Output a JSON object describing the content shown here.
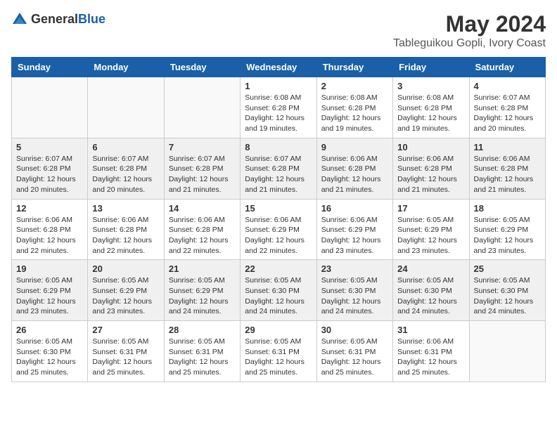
{
  "logo": {
    "text_general": "General",
    "text_blue": "Blue"
  },
  "header": {
    "title": "May 2024",
    "subtitle": "Tableguikou Gopli, Ivory Coast"
  },
  "calendar": {
    "days_of_week": [
      "Sunday",
      "Monday",
      "Tuesday",
      "Wednesday",
      "Thursday",
      "Friday",
      "Saturday"
    ],
    "weeks": [
      {
        "shaded": false,
        "days": [
          {
            "number": "",
            "info": ""
          },
          {
            "number": "",
            "info": ""
          },
          {
            "number": "",
            "info": ""
          },
          {
            "number": "1",
            "info": "Sunrise: 6:08 AM\nSunset: 6:28 PM\nDaylight: 12 hours\nand 19 minutes."
          },
          {
            "number": "2",
            "info": "Sunrise: 6:08 AM\nSunset: 6:28 PM\nDaylight: 12 hours\nand 19 minutes."
          },
          {
            "number": "3",
            "info": "Sunrise: 6:08 AM\nSunset: 6:28 PM\nDaylight: 12 hours\nand 19 minutes."
          },
          {
            "number": "4",
            "info": "Sunrise: 6:07 AM\nSunset: 6:28 PM\nDaylight: 12 hours\nand 20 minutes."
          }
        ]
      },
      {
        "shaded": true,
        "days": [
          {
            "number": "5",
            "info": "Sunrise: 6:07 AM\nSunset: 6:28 PM\nDaylight: 12 hours\nand 20 minutes."
          },
          {
            "number": "6",
            "info": "Sunrise: 6:07 AM\nSunset: 6:28 PM\nDaylight: 12 hours\nand 20 minutes."
          },
          {
            "number": "7",
            "info": "Sunrise: 6:07 AM\nSunset: 6:28 PM\nDaylight: 12 hours\nand 21 minutes."
          },
          {
            "number": "8",
            "info": "Sunrise: 6:07 AM\nSunset: 6:28 PM\nDaylight: 12 hours\nand 21 minutes."
          },
          {
            "number": "9",
            "info": "Sunrise: 6:06 AM\nSunset: 6:28 PM\nDaylight: 12 hours\nand 21 minutes."
          },
          {
            "number": "10",
            "info": "Sunrise: 6:06 AM\nSunset: 6:28 PM\nDaylight: 12 hours\nand 21 minutes."
          },
          {
            "number": "11",
            "info": "Sunrise: 6:06 AM\nSunset: 6:28 PM\nDaylight: 12 hours\nand 21 minutes."
          }
        ]
      },
      {
        "shaded": false,
        "days": [
          {
            "number": "12",
            "info": "Sunrise: 6:06 AM\nSunset: 6:28 PM\nDaylight: 12 hours\nand 22 minutes."
          },
          {
            "number": "13",
            "info": "Sunrise: 6:06 AM\nSunset: 6:28 PM\nDaylight: 12 hours\nand 22 minutes."
          },
          {
            "number": "14",
            "info": "Sunrise: 6:06 AM\nSunset: 6:28 PM\nDaylight: 12 hours\nand 22 minutes."
          },
          {
            "number": "15",
            "info": "Sunrise: 6:06 AM\nSunset: 6:29 PM\nDaylight: 12 hours\nand 22 minutes."
          },
          {
            "number": "16",
            "info": "Sunrise: 6:06 AM\nSunset: 6:29 PM\nDaylight: 12 hours\nand 23 minutes."
          },
          {
            "number": "17",
            "info": "Sunrise: 6:05 AM\nSunset: 6:29 PM\nDaylight: 12 hours\nand 23 minutes."
          },
          {
            "number": "18",
            "info": "Sunrise: 6:05 AM\nSunset: 6:29 PM\nDaylight: 12 hours\nand 23 minutes."
          }
        ]
      },
      {
        "shaded": true,
        "days": [
          {
            "number": "19",
            "info": "Sunrise: 6:05 AM\nSunset: 6:29 PM\nDaylight: 12 hours\nand 23 minutes."
          },
          {
            "number": "20",
            "info": "Sunrise: 6:05 AM\nSunset: 6:29 PM\nDaylight: 12 hours\nand 23 minutes."
          },
          {
            "number": "21",
            "info": "Sunrise: 6:05 AM\nSunset: 6:29 PM\nDaylight: 12 hours\nand 24 minutes."
          },
          {
            "number": "22",
            "info": "Sunrise: 6:05 AM\nSunset: 6:30 PM\nDaylight: 12 hours\nand 24 minutes."
          },
          {
            "number": "23",
            "info": "Sunrise: 6:05 AM\nSunset: 6:30 PM\nDaylight: 12 hours\nand 24 minutes."
          },
          {
            "number": "24",
            "info": "Sunrise: 6:05 AM\nSunset: 6:30 PM\nDaylight: 12 hours\nand 24 minutes."
          },
          {
            "number": "25",
            "info": "Sunrise: 6:05 AM\nSunset: 6:30 PM\nDaylight: 12 hours\nand 24 minutes."
          }
        ]
      },
      {
        "shaded": false,
        "days": [
          {
            "number": "26",
            "info": "Sunrise: 6:05 AM\nSunset: 6:30 PM\nDaylight: 12 hours\nand 25 minutes."
          },
          {
            "number": "27",
            "info": "Sunrise: 6:05 AM\nSunset: 6:31 PM\nDaylight: 12 hours\nand 25 minutes."
          },
          {
            "number": "28",
            "info": "Sunrise: 6:05 AM\nSunset: 6:31 PM\nDaylight: 12 hours\nand 25 minutes."
          },
          {
            "number": "29",
            "info": "Sunrise: 6:05 AM\nSunset: 6:31 PM\nDaylight: 12 hours\nand 25 minutes."
          },
          {
            "number": "30",
            "info": "Sunrise: 6:05 AM\nSunset: 6:31 PM\nDaylight: 12 hours\nand 25 minutes."
          },
          {
            "number": "31",
            "info": "Sunrise: 6:06 AM\nSunset: 6:31 PM\nDaylight: 12 hours\nand 25 minutes."
          },
          {
            "number": "",
            "info": ""
          }
        ]
      }
    ]
  }
}
